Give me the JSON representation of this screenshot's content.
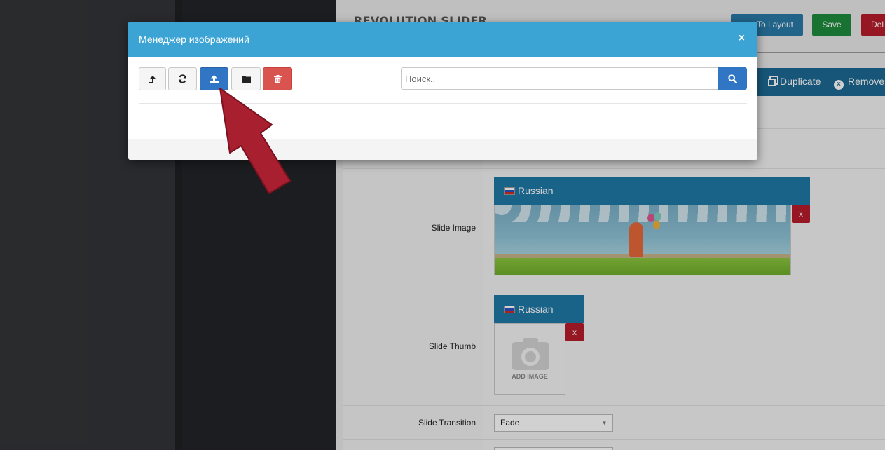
{
  "background": {
    "heading": "REVOLUTION SLIDER",
    "buttons": {
      "layout": "To Layout",
      "save": "Save",
      "delete": "Del"
    },
    "actions": {
      "duplicate": "Duplicate",
      "remove": "Remove"
    },
    "form": {
      "slide_image_label": "Slide Image",
      "slide_thumb_label": "Slide Thumb",
      "slide_transition_label": "Slide Transition",
      "language": "Russian",
      "remove_x": "x",
      "add_image": "ADD IMAGE",
      "transition_value": "Fade"
    }
  },
  "modal": {
    "title": "Менеджер изображений",
    "close": "×",
    "search_placeholder": "Поиск.."
  },
  "colors": {
    "header": "#3ca3d5",
    "primary": "#3176c4",
    "danger": "#d9534f",
    "arrow": "#a8202f"
  }
}
